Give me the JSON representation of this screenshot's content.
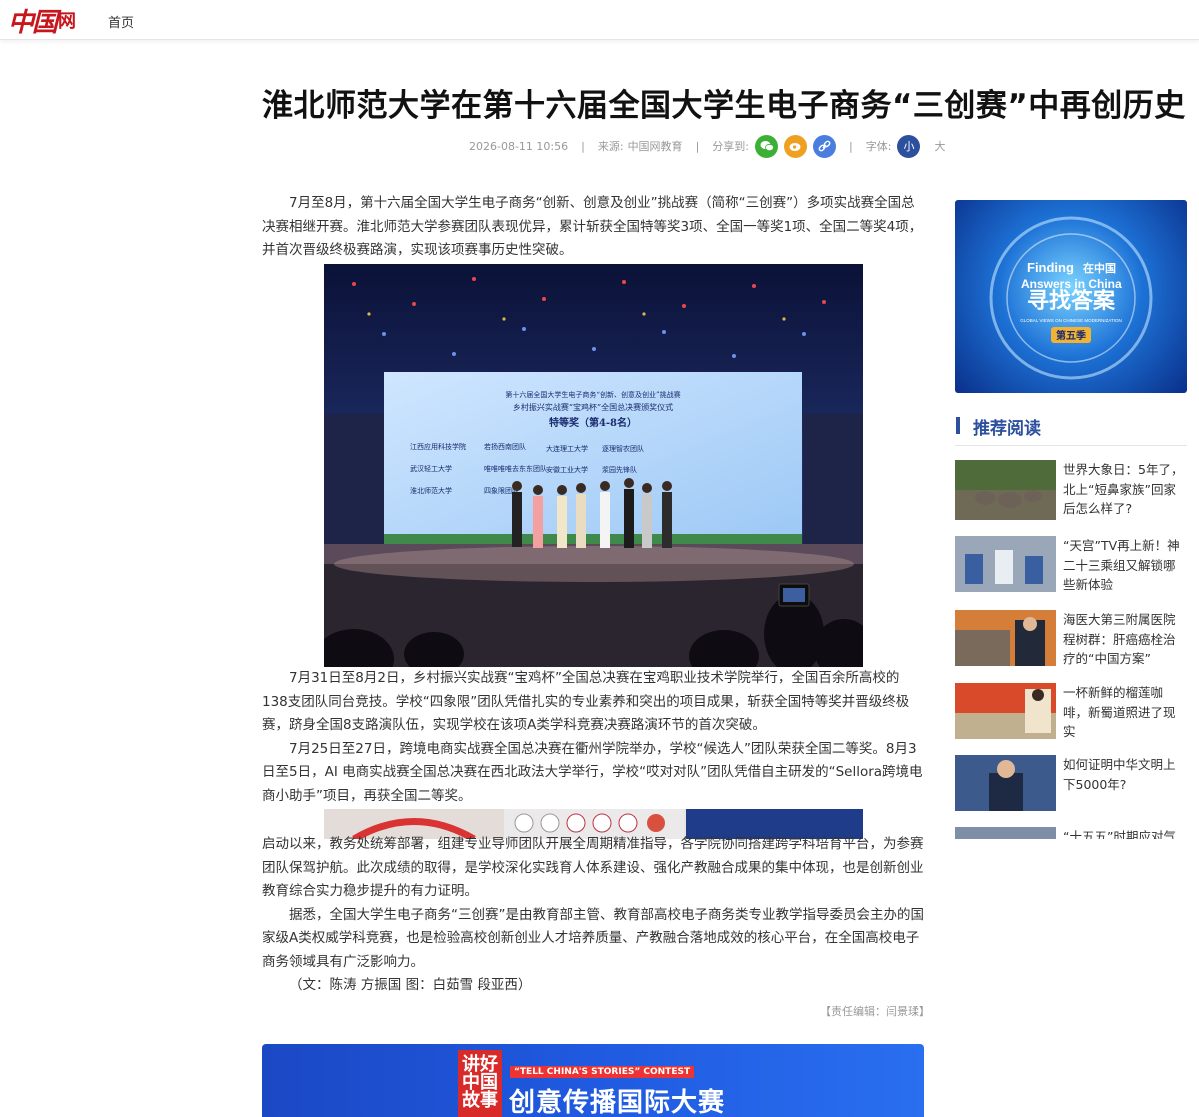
{
  "header": {
    "logo_mark": "中国",
    "logo_net": "网",
    "nav_home": "首页"
  },
  "article": {
    "title": "淮北师范大学在第十六届全国大学生电子商务“三创赛”中再创历史",
    "meta": {
      "datetime": "2026-08-11 10:56",
      "source_label": "来源:",
      "source": "中国网教育",
      "share_label": "分享到:",
      "font_label": "字体:",
      "font_small": "小",
      "font_big": "大"
    },
    "para1": "7月至8月，第十六届全国大学生电子商务“创新、创意及创业”挑战赛（简称“三创赛”）多项实战赛全国总决赛相继开赛。淮北师范大学参赛团队表现优异，累计斩获全国特等奖3项、全国一等奖1项、全国二等奖4项，并首次晋级终极赛路演，实现该项赛事历史性突破。",
    "para2": "7月31日至8月2日，乡村振兴实战赛“宝鸡杯”全国总决赛在宝鸡职业技术学院举行，全国百余所高校的138支团队同台竞技。学校“四象限”团队凭借扎实的专业素养和突出的项目成果，斩获全国特等奖并晋级终极赛，跻身全国8支路演队伍，实现学校在该项A类学科竞赛决赛路演环节的首次突破。",
    "para3": "7月25日至27日，跨境电商实战赛全国总决赛在衢州学院举办，学校“候选人”团队荣获全国二等奖。8月3日至5日，AI 电商实战赛全国总决赛在西北政法大学举行，学校“哎对对队”团队凭借自主研发的“Sellora跨境电商小助手”项目，再获全国二等奖。",
    "para4": "启动以来，教务处统筹部署，组建专业导师团队开展全周期精准指导，各学院协同搭建跨学科培育平台，为参赛团队保驾护航。此次成绩的取得，是学校深化实践育人体系建设、强化产教融合成果的集中体现，也是创新创业教育综合实力稳步提升的有力证明。",
    "para5": "据悉，全国大学生电子商务“三创赛”是由教育部主管、教育部高校电子商务类专业教学指导委员会主办的国家级A类权威学科竞赛，也是检验高校创新创业人才培养质量、产教融合落地成效的核心平台，在全国高校电子商务领域具有广泛影响力。",
    "para6": "（文：陈涛 方振国 图：白茹雪 段亚西）",
    "editor": "【责任编辑：闫景瑈】"
  },
  "photo": {
    "screen_line1": "第十六届全国大学生电子商务“创新、创意及创业”挑战赛",
    "screen_line2": "乡村振兴实战赛“宝鸡杯”全国总决赛颁奖仪式",
    "screen_line3": "特等奖（第4-8名）",
    "teams": [
      "江西应用科技学院",
      "若扬西南团队",
      "大连理工大学",
      "逐理智农团队",
      "武汉轻工大学",
      "唯唯唯唯去东东团队",
      "安徽工业大学",
      "浆园先锋队",
      "淮北师范大学",
      "四象限团队"
    ]
  },
  "banner": {
    "logo_text": "讲好中国故事",
    "sub": "“TELL CHINA'S STORIES” CONTEST",
    "main": "创意传播国际大赛"
  },
  "sidebar": {
    "ad": {
      "line1": "Finding",
      "line1b": "在中国",
      "line2": "Answers in China",
      "line3": "寻找答案",
      "line4": "GLOBAL VIEWS ON CHINESE MODERNIZATION",
      "season": "第五季"
    },
    "heading": "推荐阅读",
    "items": [
      {
        "title": "世界大象日：5年了，北上“短鼻家族”回家后怎么样了?"
      },
      {
        "title": "“天宫”TV再上新！神二十三乘组又解锁哪些新体验"
      },
      {
        "title": "海医大第三附属医院程树群：肝癌癌栓治疗的“中国方案”"
      },
      {
        "title": "一杯新鲜的榴莲咖啡，新蜀道照进了现实"
      },
      {
        "title": "如何证明中华文明上下5000年?"
      },
      {
        "title": "“十五五”时期应对气候"
      }
    ]
  }
}
